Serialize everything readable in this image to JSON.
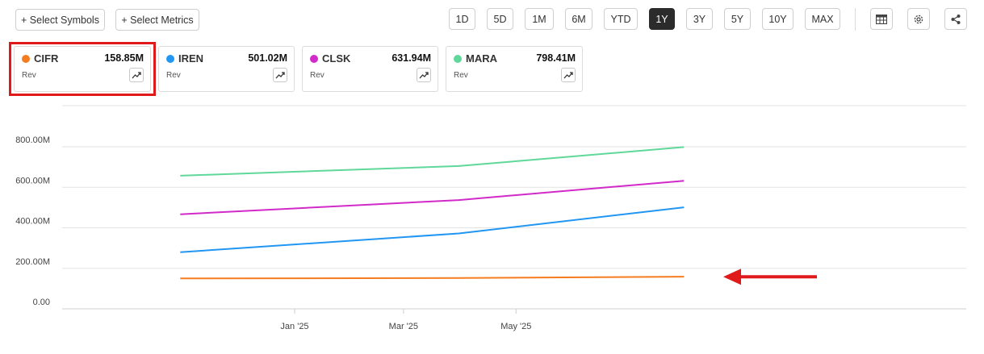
{
  "toolbar": {
    "select_symbols": "+ Select Symbols",
    "select_metrics": "+ Select Metrics",
    "ranges": [
      "1D",
      "5D",
      "1M",
      "6M",
      "YTD",
      "1Y",
      "3Y",
      "5Y",
      "10Y",
      "MAX"
    ],
    "active_range": "1Y",
    "icons": [
      "table-icon",
      "gear-icon",
      "share-icon"
    ]
  },
  "cards": [
    {
      "symbol": "CIFR",
      "value": "158.85M",
      "metric": "Rev",
      "color": "#f57c1f"
    },
    {
      "symbol": "IREN",
      "value": "501.02M",
      "metric": "Rev",
      "color": "#2196f3"
    },
    {
      "symbol": "CLSK",
      "value": "631.94M",
      "metric": "Rev",
      "color": "#d12ac9"
    },
    {
      "symbol": "MARA",
      "value": "798.41M",
      "metric": "Rev",
      "color": "#5fd89a"
    }
  ],
  "annotations": {
    "highlight_color": "#e0191b",
    "arrow_color": "#e0191b"
  },
  "chart_data": {
    "type": "line",
    "x": [
      "2024-10-31",
      "2025-03-31",
      "2025-07-31"
    ],
    "xticks": [
      "2025-01-01",
      "2025-03-01",
      "2025-05-01"
    ],
    "xtick_labels": [
      "Jan '25",
      "Mar '25",
      "May '25"
    ],
    "xlim": [
      "2024-08-28",
      "2025-12-31"
    ],
    "ylim": [
      0,
      800
    ],
    "yticks": [
      0,
      200,
      400,
      600,
      800
    ],
    "ytick_labels": [
      "0.00",
      "200.00M",
      "400.00M",
      "600.00M",
      "800.00M"
    ],
    "yunit": "M",
    "grid": true,
    "series": [
      {
        "name": "CIFR",
        "color": "#f57c1f",
        "values": [
          150,
          152,
          158.85
        ]
      },
      {
        "name": "IREN",
        "color": "#2196f3",
        "values": [
          280,
          372,
          501.02
        ]
      },
      {
        "name": "CLSK",
        "color": "#d12ac9",
        "values": [
          467,
          537,
          631.94
        ]
      },
      {
        "name": "MARA",
        "color": "#5fd89a",
        "values": [
          657,
          705,
          798.41
        ]
      }
    ]
  }
}
